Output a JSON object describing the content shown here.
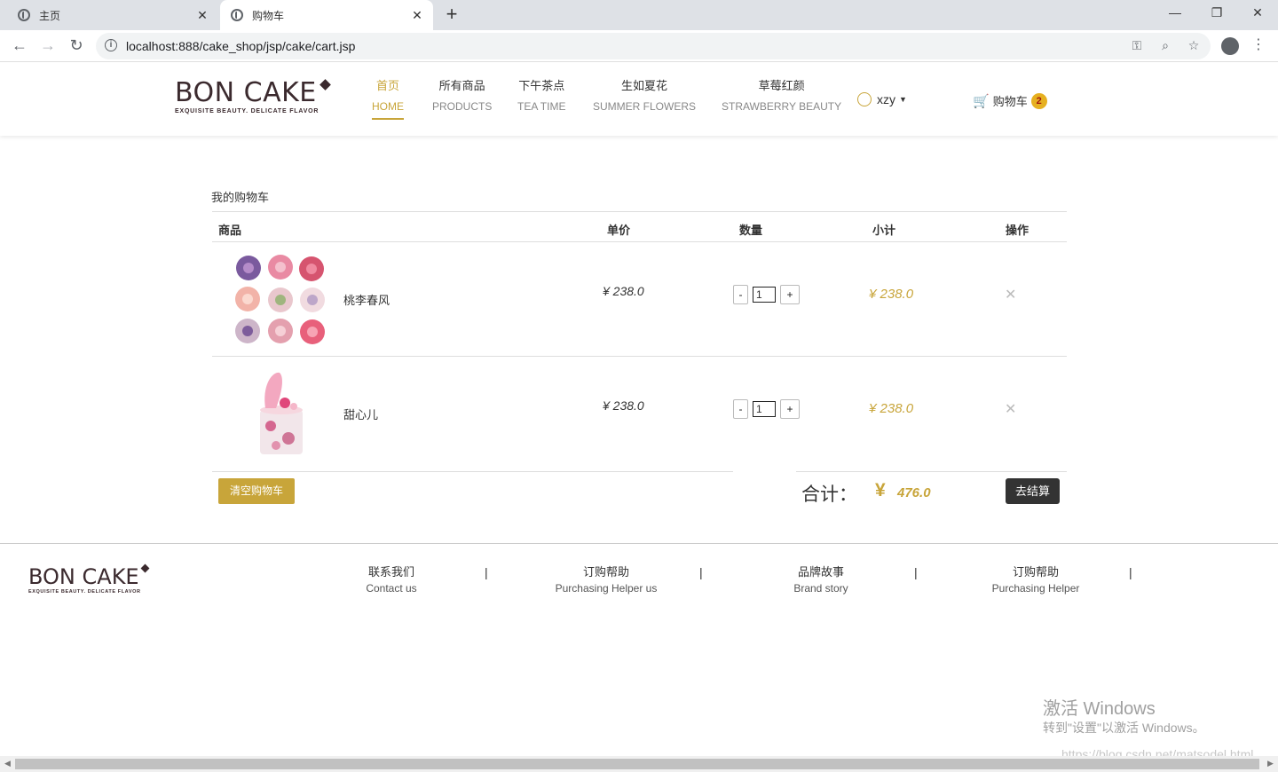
{
  "browser": {
    "tabs": [
      {
        "title": "主页",
        "active": false
      },
      {
        "title": "购物车",
        "active": true
      }
    ],
    "url": "localhost:888/cake_shop/jsp/cake/cart.jsp"
  },
  "header": {
    "logo": {
      "brand": "BON CAKE",
      "tagline": "EXQUISITE BEAUTY. DELICATE FLAVOR"
    },
    "menu": [
      {
        "zh": "首页",
        "en": "HOME",
        "active": true
      },
      {
        "zh": "所有商品",
        "en": "PRODUCTS",
        "active": false
      },
      {
        "zh": "下午茶点",
        "en": "TEA TIME",
        "active": false
      },
      {
        "zh": "生如夏花",
        "en": "SUMMER FLOWERS",
        "active": false
      },
      {
        "zh": "草莓红颜",
        "en": "STRAWBERRY BEAUTY",
        "active": false
      }
    ],
    "user": "xzy",
    "cart_label": "购物车",
    "cart_count": "2"
  },
  "cart": {
    "title": "我的购物车",
    "columns": {
      "product": "商品",
      "price": "单价",
      "quantity": "数量",
      "subtotal": "小计",
      "action": "操作"
    },
    "items": [
      {
        "name": "桃李春风",
        "price": "¥ 238.0",
        "quantity": "1",
        "subtotal": "¥ 238.0"
      },
      {
        "name": "甜心儿",
        "price": "¥ 238.0",
        "quantity": "1",
        "subtotal": "¥ 238.0"
      }
    ],
    "clear_label": "清空购物车",
    "total_label": "合计：",
    "total_currency": "¥",
    "total_value": "476.0",
    "checkout_label": "去结算"
  },
  "footer": {
    "logo": {
      "brand": "BON CAKE",
      "tagline": "EXQUISITE BEAUTY. DELICATE FLAVOR"
    },
    "columns": [
      {
        "zh": "联系我们",
        "en": "Contact us"
      },
      {
        "zh": "订购帮助",
        "en": "Purchasing Helper us"
      },
      {
        "zh": "品牌故事",
        "en": "Brand story"
      },
      {
        "zh": "订购帮助",
        "en": "Purchasing Helper"
      }
    ]
  },
  "watermark": {
    "line1": "激活 Windows",
    "line2": "转到\"设置\"以激活 Windows。",
    "line3": "https://blog.csdn.net/matsodel.html"
  },
  "colors": {
    "accent": "#c8a53a",
    "dark": "#333333",
    "brand": "#3b2a2e"
  }
}
